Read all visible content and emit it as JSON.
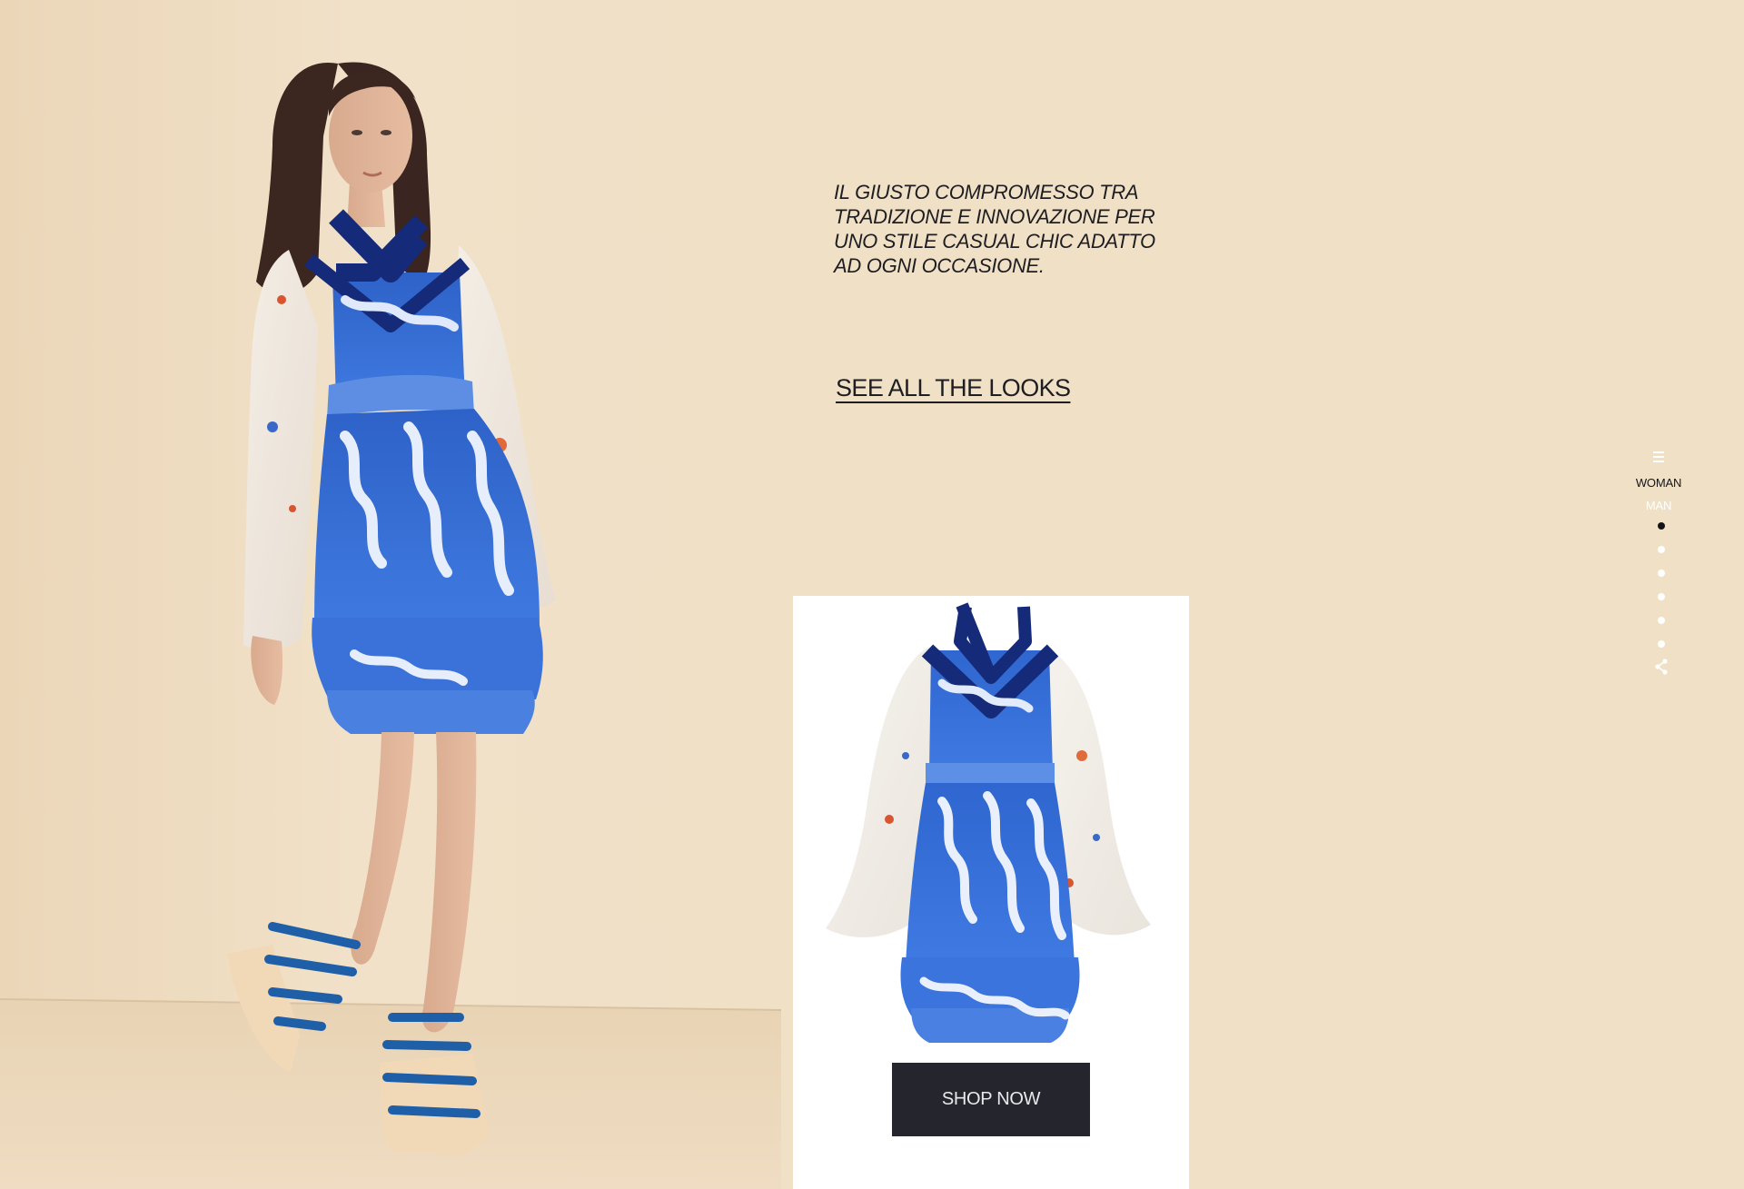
{
  "page": {
    "background_color": "#f0e0c6"
  },
  "hero": {
    "image_icon": "model-photo"
  },
  "copy": {
    "tagline_lines": [
      "IL GIUSTO COMPROMESSO TRA",
      "TRADIZIONE E INNOVAZIONE PER",
      "UNO STILE CASUAL CHIC ADATTO",
      "AD OGNI OCCASIONE."
    ],
    "see_all_label": "SEE ALL THE LOOKS"
  },
  "product": {
    "image_icon": "dress-product-image",
    "shop_now_label": "SHOP NOW",
    "button_color": "#25252d"
  },
  "nav": {
    "menu_icon": "hamburger-icon",
    "woman_label": "WOMAN",
    "man_label": "MAN",
    "active_slide": 1,
    "slide_count": 6,
    "share_icon": "share-icon"
  }
}
